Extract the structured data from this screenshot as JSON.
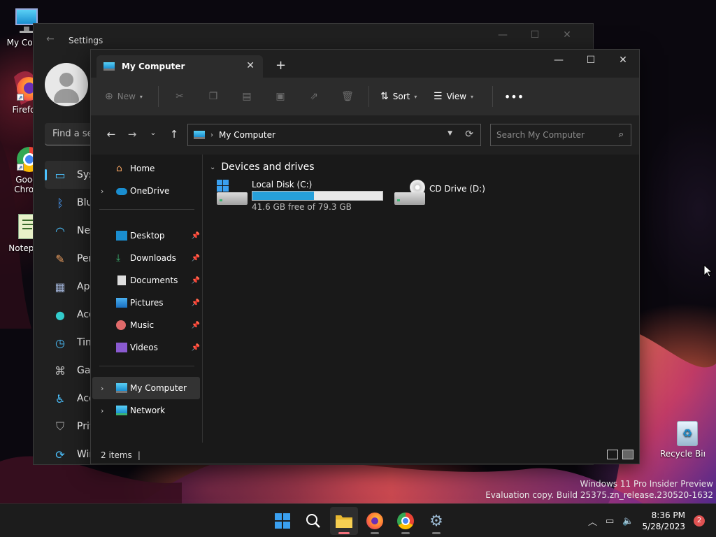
{
  "desktop": {
    "icons": [
      {
        "label": "My Com",
        "icon": "computer-icon"
      },
      {
        "label": "Firefo",
        "icon": "firefox-icon"
      },
      {
        "label": "Goog Chron",
        "icon": "chrome-icon"
      },
      {
        "label": "Notepa",
        "icon": "notepad-icon"
      },
      {
        "label": "Recycle Bin",
        "icon": "recycle-bin-icon"
      }
    ],
    "watermark": {
      "line1": "Windows 11 Pro Insider Preview",
      "line2": "Evaluation copy. Build 25375.zn_release.230520-1632"
    }
  },
  "settings": {
    "title": "Settings",
    "search_placeholder": "Find a se",
    "nav": [
      "Syst",
      "Blue",
      "Net",
      "Pers",
      "App",
      "Acc",
      "Tim",
      "Gar",
      "Acc",
      "Priv",
      "Wir"
    ]
  },
  "explorer": {
    "tab_title": "My Computer",
    "toolbar": {
      "new_label": "New",
      "sort_label": "Sort",
      "view_label": "View"
    },
    "address": "My Computer",
    "search_placeholder": "Search My Computer",
    "nav_pane": {
      "home": "Home",
      "onedrive": "OneDrive",
      "quick": [
        "Desktop",
        "Downloads",
        "Documents",
        "Pictures",
        "Music",
        "Videos"
      ],
      "my_computer": "My Computer",
      "network": "Network"
    },
    "section_title": "Devices and drives",
    "drives": [
      {
        "name": "Local Disk (C:)",
        "free_text": "41.6 GB free of 79.3 GB",
        "used_fraction": 0.475
      },
      {
        "name": "CD Drive (D:)"
      }
    ],
    "status": "2 items"
  },
  "taskbar": {
    "time": "8:36 PM",
    "date": "5/28/2023",
    "notifications": "2"
  },
  "colors": {
    "accent": "#4cc2ff",
    "drive_bar": "#26a0da",
    "badge": "#e05252"
  }
}
